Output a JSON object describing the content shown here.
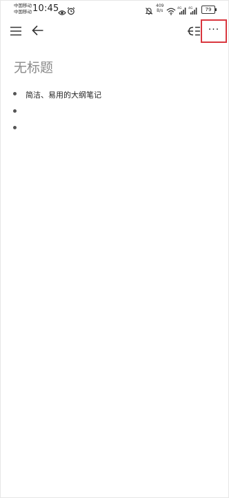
{
  "status_bar": {
    "carrier_1": "中国移动",
    "carrier_2": "中国移动",
    "time": "10:45",
    "net_speed_value": "409",
    "net_speed_unit": "B/s",
    "network_1": "4G",
    "network_2": "4G",
    "battery": "79"
  },
  "toolbar": {
    "more_label": "···"
  },
  "document": {
    "title": "无标题",
    "items": [
      {
        "text": "简洁、易用的大纲笔记"
      },
      {
        "text": ""
      },
      {
        "text": ""
      }
    ]
  },
  "colors": {
    "highlight": "#d9363e",
    "title": "#8a8a8a",
    "text": "#222222"
  },
  "icons": [
    "eye-icon",
    "alarm-icon",
    "bell-off-icon",
    "wifi-icon",
    "signal-icon",
    "battery-icon",
    "menu-icon",
    "back-arrow-icon",
    "indent-icon",
    "more-icon"
  ]
}
